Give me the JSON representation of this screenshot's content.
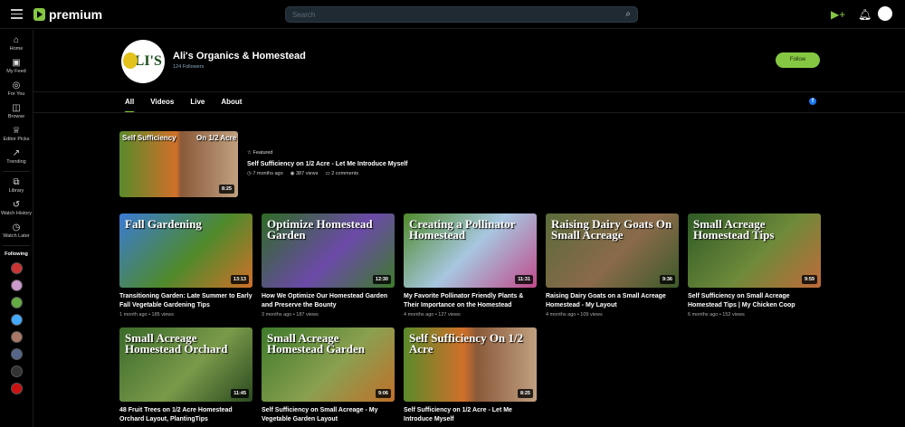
{
  "header": {
    "logo": "premium",
    "search_placeholder": "Search"
  },
  "sidebar": {
    "items": [
      {
        "label": "Home",
        "icon": "⌂"
      },
      {
        "label": "My Feed",
        "icon": "▣"
      },
      {
        "label": "For You",
        "icon": "◎"
      },
      {
        "label": "Browse",
        "icon": "◫"
      },
      {
        "label": "Editor Picks",
        "icon": "♕"
      },
      {
        "label": "Trending",
        "icon": "↗"
      },
      {
        "label": "Library",
        "icon": "⧉"
      },
      {
        "label": "Watch History",
        "icon": "↺"
      },
      {
        "label": "Watch Later",
        "icon": "◷"
      }
    ],
    "following_label": "Following",
    "following_colors": [
      "#c33",
      "#c9c",
      "#6a4",
      "#4af",
      "#a76",
      "#568",
      "#333",
      "#c11"
    ]
  },
  "channel": {
    "name": "Ali's Organics & Homestead",
    "followers": "124 Followers",
    "avatar_text": "ALI'S",
    "follow": "Follow"
  },
  "tabs": [
    "All",
    "Videos",
    "Live",
    "About"
  ],
  "featured": {
    "label": "Featured",
    "title": "Self Sufficiency on 1/2 Acre - Let Me Introduce Myself",
    "age": "7 months ago",
    "views": "387 views",
    "comments": "2 comments",
    "duration": "8:25",
    "thumb_left": "Self Sufficiency",
    "thumb_right": "On 1/2 Acre"
  },
  "videos": [
    {
      "title": "Transitioning Garden: Late Summer to Early Fall Vegetable Gardening Tips",
      "meta": "1 month ago • 185 views",
      "duration": "13:13",
      "thumb": "Fall Gardening",
      "bg": "linear-gradient(135deg,#3a7bd5,#4f8a2b 55%,#d0702a)"
    },
    {
      "title": "How We Optimize Our Homestead Garden and Preserve the Bounty",
      "meta": "3 months ago • 187 views",
      "duration": "12:30",
      "thumb": "Optimize Homestead Garden",
      "bg": "linear-gradient(135deg,#2f6b24,#6b4aa8 55%,#3d7a2a)"
    },
    {
      "title": "My Favorite Pollinator Friendly Plants & Their Importance on the Homestead",
      "meta": "4 months ago • 127 views",
      "duration": "11:31",
      "thumb": "Creating a Pollinator Homestead",
      "bg": "linear-gradient(135deg,#4f8a2b,#a7c7e0 50%,#c04a8a)"
    },
    {
      "title": "Raising Dairy Goats on a Small Acreage Homestead - My Layout",
      "meta": "4 months ago • 109 views",
      "duration": "9:36",
      "thumb": "Raising Dairy Goats On Small Acreage",
      "bg": "linear-gradient(135deg,#5a6b3a,#8a6a4a 55%,#3d5a2a)"
    },
    {
      "title": "Self Sufficiency on Small Acreage Homestead Tips | My Chicken Coop",
      "meta": "6 months ago • 152 views",
      "duration": "9:59",
      "thumb": "Small Acreage Homestead Tips",
      "bg": "linear-gradient(135deg,#2e5a26,#6e8a3a 55%,#c06a3a)"
    },
    {
      "title": "48 Fruit Trees on 1/2 Acre Homestead Orchard Layout, PlantingTips",
      "meta": "",
      "duration": "11:45",
      "thumb": "Small Acreage Homestead Orchard",
      "bg": "linear-gradient(135deg,#3a6a2a,#7a9a4a 55%,#2a4a20)"
    },
    {
      "title": "Self Sufficiency on Small Acreage - My Vegetable Garden Layout",
      "meta": "",
      "duration": "9:06",
      "thumb": "Small Acreage Homestead Garden",
      "bg": "linear-gradient(135deg,#3d7a2a,#8aa050 55%,#c0702a)"
    },
    {
      "title": "Self Sufficiency on 1/2 Acre - Let Me Introduce Myself",
      "meta": "",
      "duration": "8:25",
      "thumb": "Self Sufficiency On 1/2 Acre",
      "bg": "linear-gradient(90deg,#5a8a2a,#d0702a 45%,#8a5a3a 55%,#c0a080)"
    }
  ]
}
